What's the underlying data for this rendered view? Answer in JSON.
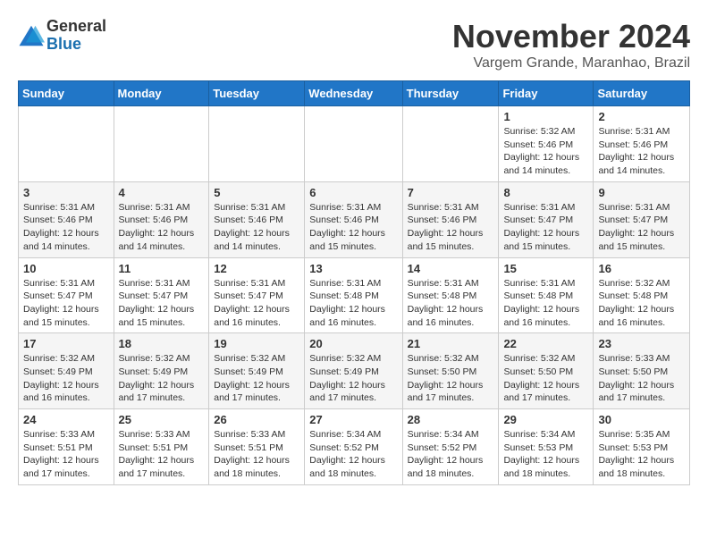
{
  "logo": {
    "general": "General",
    "blue": "Blue"
  },
  "title": "November 2024",
  "location": "Vargem Grande, Maranhao, Brazil",
  "days_of_week": [
    "Sunday",
    "Monday",
    "Tuesday",
    "Wednesday",
    "Thursday",
    "Friday",
    "Saturday"
  ],
  "weeks": [
    [
      {
        "day": "",
        "info": ""
      },
      {
        "day": "",
        "info": ""
      },
      {
        "day": "",
        "info": ""
      },
      {
        "day": "",
        "info": ""
      },
      {
        "day": "",
        "info": ""
      },
      {
        "day": "1",
        "info": "Sunrise: 5:32 AM\nSunset: 5:46 PM\nDaylight: 12 hours and 14 minutes."
      },
      {
        "day": "2",
        "info": "Sunrise: 5:31 AM\nSunset: 5:46 PM\nDaylight: 12 hours and 14 minutes."
      }
    ],
    [
      {
        "day": "3",
        "info": "Sunrise: 5:31 AM\nSunset: 5:46 PM\nDaylight: 12 hours and 14 minutes."
      },
      {
        "day": "4",
        "info": "Sunrise: 5:31 AM\nSunset: 5:46 PM\nDaylight: 12 hours and 14 minutes."
      },
      {
        "day": "5",
        "info": "Sunrise: 5:31 AM\nSunset: 5:46 PM\nDaylight: 12 hours and 14 minutes."
      },
      {
        "day": "6",
        "info": "Sunrise: 5:31 AM\nSunset: 5:46 PM\nDaylight: 12 hours and 15 minutes."
      },
      {
        "day": "7",
        "info": "Sunrise: 5:31 AM\nSunset: 5:46 PM\nDaylight: 12 hours and 15 minutes."
      },
      {
        "day": "8",
        "info": "Sunrise: 5:31 AM\nSunset: 5:47 PM\nDaylight: 12 hours and 15 minutes."
      },
      {
        "day": "9",
        "info": "Sunrise: 5:31 AM\nSunset: 5:47 PM\nDaylight: 12 hours and 15 minutes."
      }
    ],
    [
      {
        "day": "10",
        "info": "Sunrise: 5:31 AM\nSunset: 5:47 PM\nDaylight: 12 hours and 15 minutes."
      },
      {
        "day": "11",
        "info": "Sunrise: 5:31 AM\nSunset: 5:47 PM\nDaylight: 12 hours and 15 minutes."
      },
      {
        "day": "12",
        "info": "Sunrise: 5:31 AM\nSunset: 5:47 PM\nDaylight: 12 hours and 16 minutes."
      },
      {
        "day": "13",
        "info": "Sunrise: 5:31 AM\nSunset: 5:48 PM\nDaylight: 12 hours and 16 minutes."
      },
      {
        "day": "14",
        "info": "Sunrise: 5:31 AM\nSunset: 5:48 PM\nDaylight: 12 hours and 16 minutes."
      },
      {
        "day": "15",
        "info": "Sunrise: 5:31 AM\nSunset: 5:48 PM\nDaylight: 12 hours and 16 minutes."
      },
      {
        "day": "16",
        "info": "Sunrise: 5:32 AM\nSunset: 5:48 PM\nDaylight: 12 hours and 16 minutes."
      }
    ],
    [
      {
        "day": "17",
        "info": "Sunrise: 5:32 AM\nSunset: 5:49 PM\nDaylight: 12 hours and 16 minutes."
      },
      {
        "day": "18",
        "info": "Sunrise: 5:32 AM\nSunset: 5:49 PM\nDaylight: 12 hours and 17 minutes."
      },
      {
        "day": "19",
        "info": "Sunrise: 5:32 AM\nSunset: 5:49 PM\nDaylight: 12 hours and 17 minutes."
      },
      {
        "day": "20",
        "info": "Sunrise: 5:32 AM\nSunset: 5:49 PM\nDaylight: 12 hours and 17 minutes."
      },
      {
        "day": "21",
        "info": "Sunrise: 5:32 AM\nSunset: 5:50 PM\nDaylight: 12 hours and 17 minutes."
      },
      {
        "day": "22",
        "info": "Sunrise: 5:32 AM\nSunset: 5:50 PM\nDaylight: 12 hours and 17 minutes."
      },
      {
        "day": "23",
        "info": "Sunrise: 5:33 AM\nSunset: 5:50 PM\nDaylight: 12 hours and 17 minutes."
      }
    ],
    [
      {
        "day": "24",
        "info": "Sunrise: 5:33 AM\nSunset: 5:51 PM\nDaylight: 12 hours and 17 minutes."
      },
      {
        "day": "25",
        "info": "Sunrise: 5:33 AM\nSunset: 5:51 PM\nDaylight: 12 hours and 17 minutes."
      },
      {
        "day": "26",
        "info": "Sunrise: 5:33 AM\nSunset: 5:51 PM\nDaylight: 12 hours and 18 minutes."
      },
      {
        "day": "27",
        "info": "Sunrise: 5:34 AM\nSunset: 5:52 PM\nDaylight: 12 hours and 18 minutes."
      },
      {
        "day": "28",
        "info": "Sunrise: 5:34 AM\nSunset: 5:52 PM\nDaylight: 12 hours and 18 minutes."
      },
      {
        "day": "29",
        "info": "Sunrise: 5:34 AM\nSunset: 5:53 PM\nDaylight: 12 hours and 18 minutes."
      },
      {
        "day": "30",
        "info": "Sunrise: 5:35 AM\nSunset: 5:53 PM\nDaylight: 12 hours and 18 minutes."
      }
    ]
  ]
}
